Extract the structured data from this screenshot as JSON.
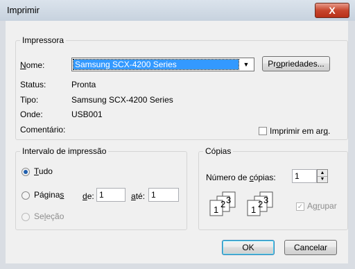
{
  "window": {
    "title": "Imprimir",
    "close_label": "X"
  },
  "printer_group": {
    "label": "Impressora",
    "name_label": "Nome:",
    "name_value": "Samsung SCX-4200 Series",
    "properties_button": "Propriedades...",
    "status_label": "Status:",
    "status_value": "Pronta",
    "type_label": "Tipo:",
    "type_value": "Samsung SCX-4200 Series",
    "where_label": "Onde:",
    "where_value": "USB001",
    "comment_label": "Comentário:",
    "print_to_file_label": "Imprimir em arq.",
    "print_to_file_checked": false
  },
  "range_group": {
    "label": "Intervalo de impressão",
    "all_label": "Tudo",
    "pages_label": "Páginas",
    "from_label": "de:",
    "from_value": "1",
    "to_label": "até:",
    "to_value": "1",
    "selection_label": "Seleção",
    "selected": "all"
  },
  "copies_group": {
    "label": "Cópias",
    "count_label": "Número de cópias:",
    "count_value": "1",
    "collate_label": "Agrupar",
    "collate_checked": true,
    "collate_pages": [
      "1",
      "2",
      "3"
    ]
  },
  "buttons": {
    "ok": "OK",
    "cancel": "Cancelar"
  }
}
